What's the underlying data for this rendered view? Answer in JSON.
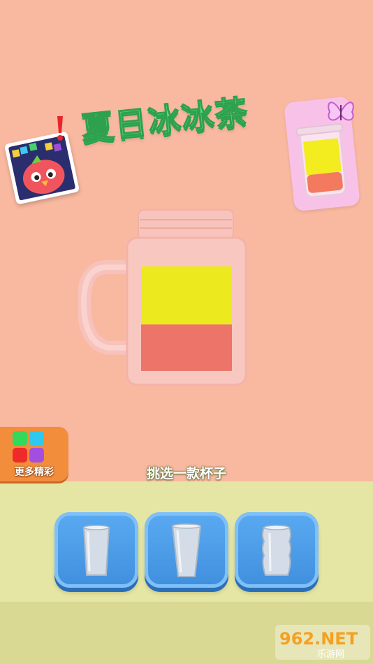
{
  "game": {
    "title": "夏日冰冰茶",
    "instruction": "挑选一款杯子",
    "more_label": "更多精彩"
  },
  "jar": {
    "fill_levels": {
      "yellow": 0.5,
      "red": 0.4
    }
  },
  "cup_options": [
    {
      "shape": "straight-cup"
    },
    {
      "shape": "tapered-cup"
    },
    {
      "shape": "wavy-cup"
    }
  ],
  "watermark": {
    "text": "962.NET",
    "subtext": "乐游网"
  },
  "colors": {
    "background": "#f9b8a0",
    "floor": "#e6e6a4",
    "title_green": "#5de07a",
    "button_blue": "#4a9be8",
    "yellow_layer": "#ecea1f",
    "red_layer": "#ec7468",
    "more_orange": "#f28d3c"
  }
}
